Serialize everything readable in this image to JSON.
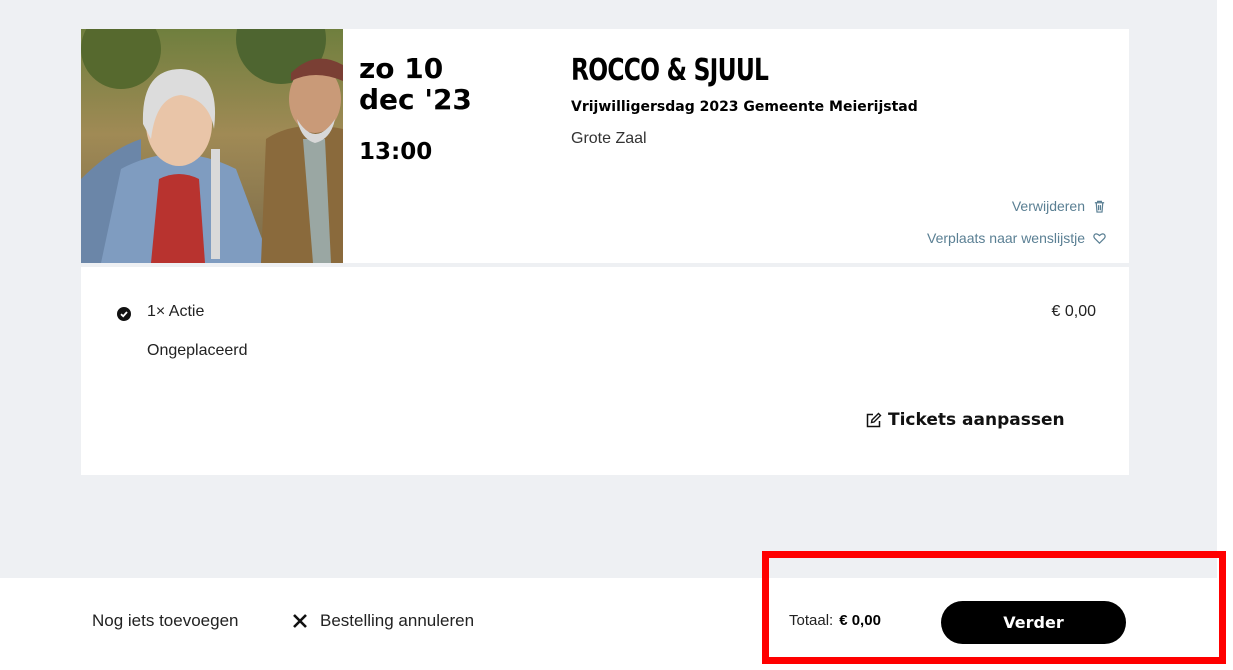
{
  "event": {
    "date_line1": "zo 10",
    "date_line2": "dec '23",
    "time": "13:00",
    "title": "ROCCO & SJUUL",
    "subtitle": "Vrijwilligersdag 2023 Gemeente Meierijstad",
    "venue": "Grote Zaal",
    "remove_label": "Verwijderen",
    "remove_icon": "trash-icon",
    "wishlist_label": "Verplaats naar wenslijstje",
    "wishlist_icon": "heart-icon"
  },
  "ticket": {
    "line": "1× Actie",
    "price": "€ 0,00",
    "status": "Ongeplaceerd",
    "adjust_label": "Tickets aanpassen",
    "adjust_icon": "edit-icon"
  },
  "footer": {
    "add_more": "Nog iets toevoegen",
    "cancel": "Bestelling annuleren",
    "total_label": "Totaal:",
    "total_value": "€ 0,00",
    "continue": "Verder"
  },
  "colors": {
    "background": "#eef0f3",
    "link": "#5a7f93",
    "button": "#000000",
    "highlight": "#ff0000"
  }
}
